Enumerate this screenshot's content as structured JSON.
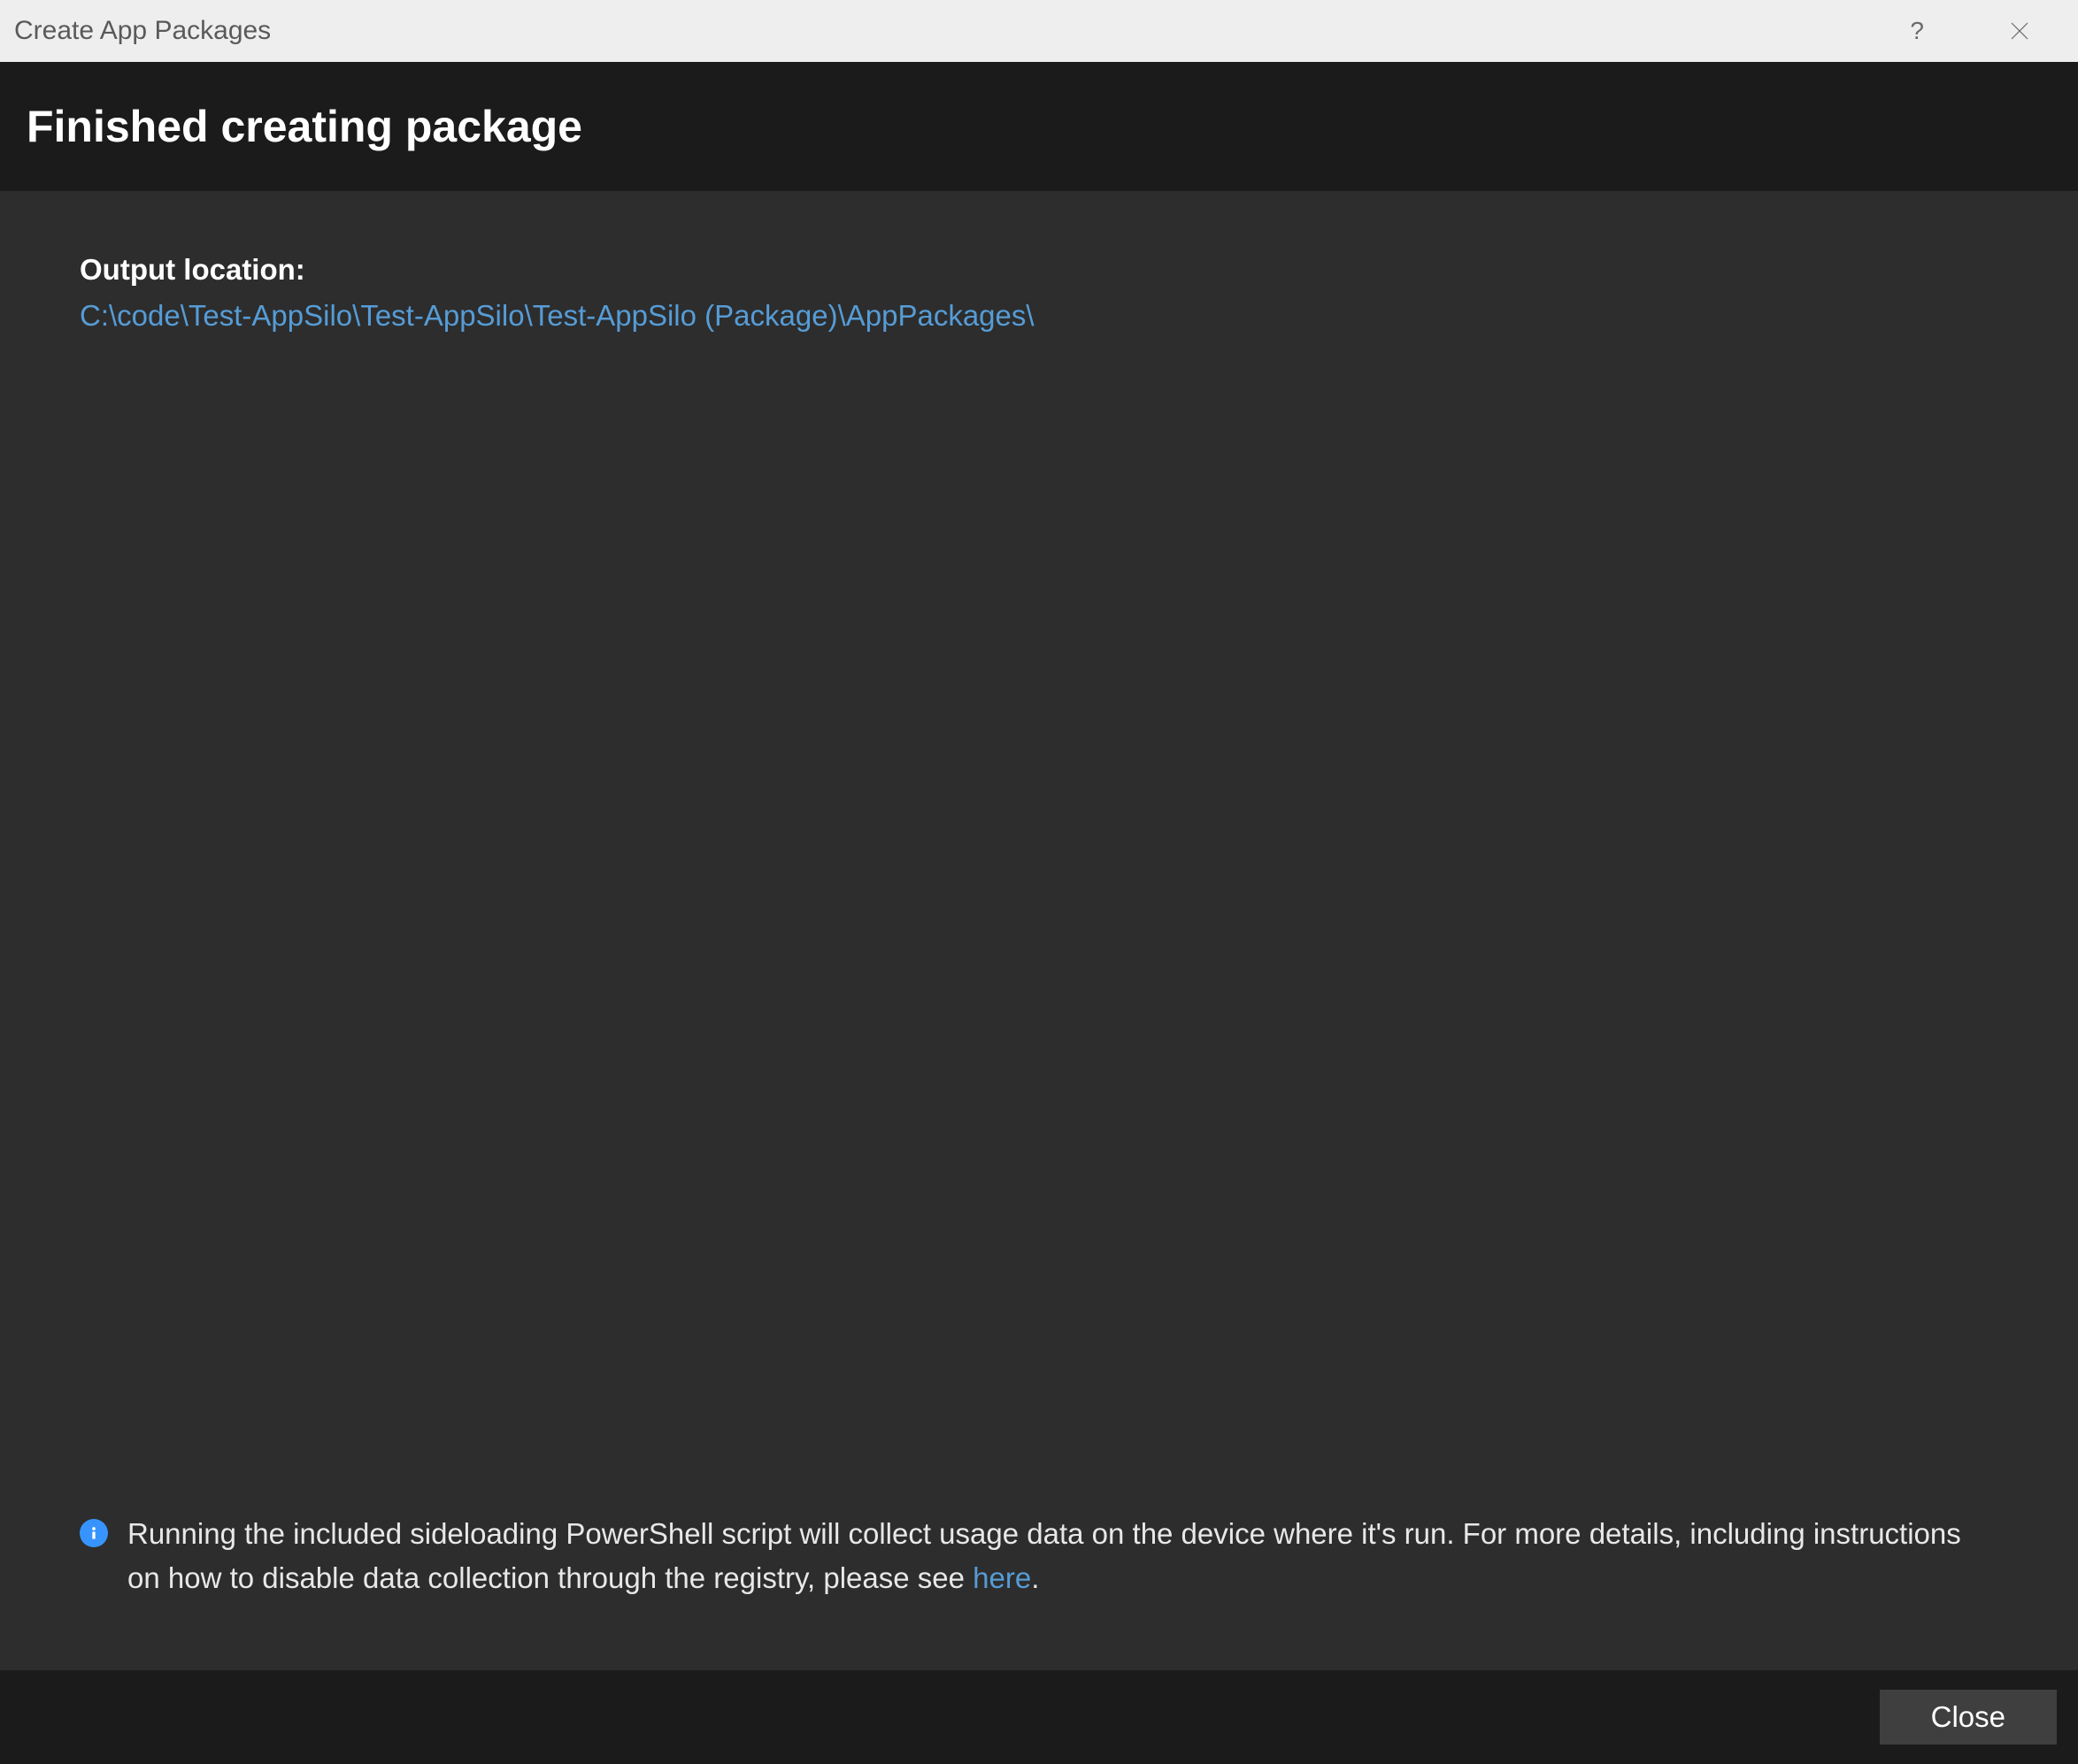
{
  "titlebar": {
    "title": "Create App Packages",
    "help_symbol": "?",
    "close_aria": "Close"
  },
  "header": {
    "title": "Finished creating package"
  },
  "content": {
    "output_label": "Output location:",
    "output_path": "C:\\code\\Test-AppSilo\\Test-AppSilo\\Test-AppSilo (Package)\\AppPackages\\"
  },
  "info": {
    "text_before_link": "Running the included sideloading PowerShell script will collect usage data on the device where it's run.  For more details, including instructions on how to disable data collection through the registry, please see  ",
    "link_text": "here",
    "text_after_link": "."
  },
  "footer": {
    "close_label": "Close"
  }
}
